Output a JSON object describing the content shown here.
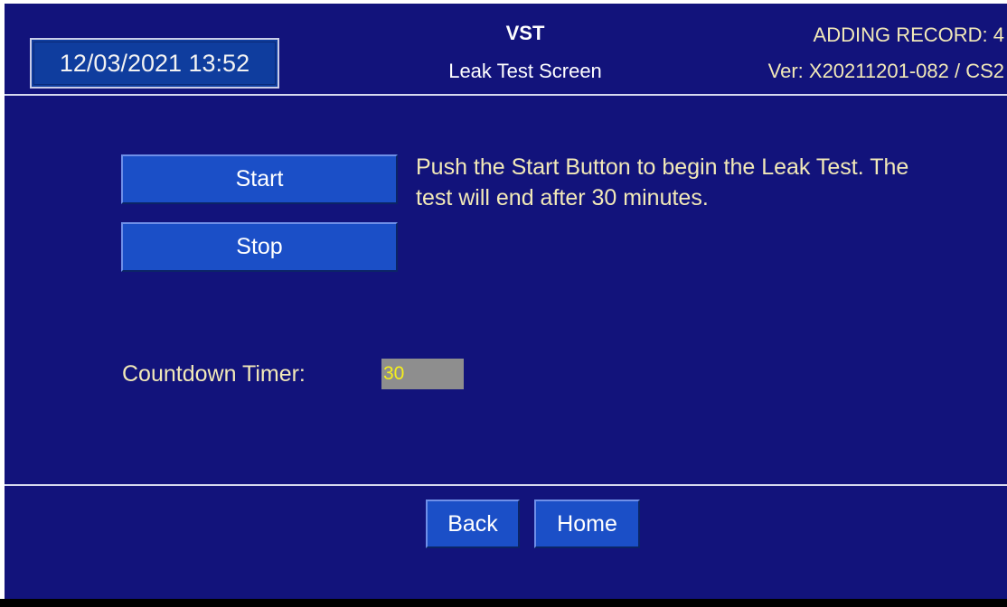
{
  "header": {
    "datetime": "12/03/2021 13:52",
    "app_name": "VST",
    "screen_title": "Leak Test Screen",
    "record_status": "ADDING RECORD: 4",
    "version": "Ver: X20211201-082 / CS2"
  },
  "controls": {
    "start_label": "Start",
    "stop_label": "Stop"
  },
  "instructions": "Push the Start Button to begin the Leak Test. The test will end after 30 minutes.",
  "timer": {
    "label": "Countdown Timer:",
    "value": "30"
  },
  "footer": {
    "back_label": "Back",
    "home_label": "Home"
  },
  "colors": {
    "background": "#12137b",
    "button": "#1b4fc7",
    "text_yellow": "#f2e9b8",
    "timer_value": "#f5ef1c",
    "timer_field": "#8e8e8e"
  }
}
